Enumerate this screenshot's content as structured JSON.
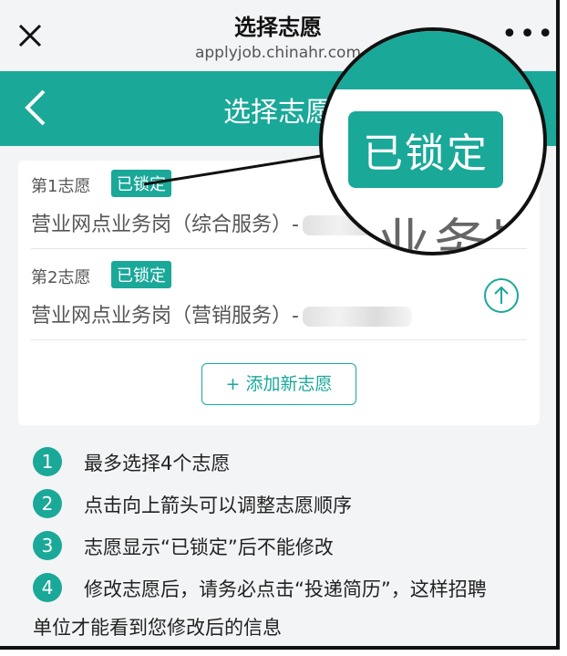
{
  "browser": {
    "title": "选择志愿",
    "url": "applyjob.chinahr.com",
    "more": "•••"
  },
  "header": {
    "title": "选择志愿"
  },
  "choices": [
    {
      "label": "第1志愿",
      "badge": "已锁定",
      "job": "营业网点业务岗（综合服务）-"
    },
    {
      "label": "第2志愿",
      "badge": "已锁定",
      "job": "营业网点业务岗（营销服务）-"
    }
  ],
  "add_button": {
    "label": "+ 添加新志愿"
  },
  "tips": [
    {
      "num": "1",
      "text": "最多选择4个志愿"
    },
    {
      "num": "2",
      "text": "点击向上箭头可以调整志愿顺序"
    },
    {
      "num": "3",
      "text": "志愿显示“已锁定”后不能修改"
    },
    {
      "num": "4",
      "text": "修改志愿后，请务必点击“投递简历”，这样招聘"
    }
  ],
  "tip_continuation": "单位才能看到您修改后的信息",
  "magnifier": {
    "badge": "已锁定",
    "text": "业务岗"
  },
  "colors": {
    "accent": "#1aa899",
    "background": "#f3f4f6"
  }
}
